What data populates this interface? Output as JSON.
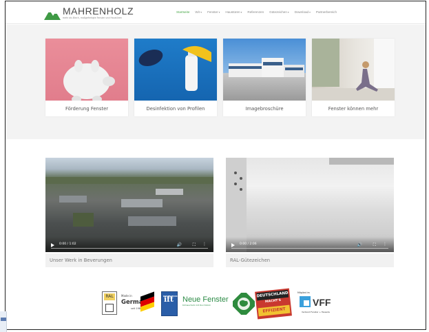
{
  "brand": {
    "name": "MAHRENHOLZ",
    "tagline": "mehr als Blech, maßgefertigte Fenster und Haustüren"
  },
  "nav": {
    "items": [
      {
        "label": "Startseite",
        "active": true,
        "dropdown": false
      },
      {
        "label": "Wir",
        "active": false,
        "dropdown": true
      },
      {
        "label": "Fenster",
        "active": false,
        "dropdown": true
      },
      {
        "label": "Haustüren",
        "active": false,
        "dropdown": true
      },
      {
        "label": "Referenzen",
        "active": false,
        "dropdown": false
      },
      {
        "label": "Gütezeichen",
        "active": false,
        "dropdown": true
      },
      {
        "label": "Download",
        "active": false,
        "dropdown": true
      },
      {
        "label": "Partnerbereich",
        "active": false,
        "dropdown": false
      }
    ],
    "caret": "▾"
  },
  "tiles": [
    {
      "label": "Förderung Fenster"
    },
    {
      "label": "Desinfektion von Profilen"
    },
    {
      "label": "Imagebroschüre"
    },
    {
      "label": "Fenster können mehr"
    }
  ],
  "videos": [
    {
      "time": "0:00 / 1:02",
      "caption": "Unser Werk in Beverungen"
    },
    {
      "time": "0:00 / 2:06",
      "caption": "RAL-Gütezeichen"
    }
  ],
  "video_controls": {
    "volume_icon": "🔊",
    "fullscreen_icon": "⛶",
    "more_icon": "⋮"
  },
  "logos": {
    "ral": "RAL",
    "made_in": "Made in",
    "germany": "Germany",
    "seal": "seit 1986",
    "ift": "ift",
    "ift_sub": "ROSENHEIM",
    "neue_fenster": "Neue Fenster",
    "neue_fenster_sub": "Klimaschutz mit Durchblick",
    "deutschland_1": "DEUTSCHLAND",
    "deutschland_2": "MACHT'S",
    "deutschland_3": "EFFIZIENT",
    "vff_member": "Mitglied im",
    "vff": "VFF",
    "vff_sub": "Verband Fenster + Fassade"
  },
  "colors": {
    "brand_green": "#4aa84a",
    "flag_black": "#000000",
    "flag_red": "#dd0000",
    "flag_gold": "#ffce00"
  }
}
